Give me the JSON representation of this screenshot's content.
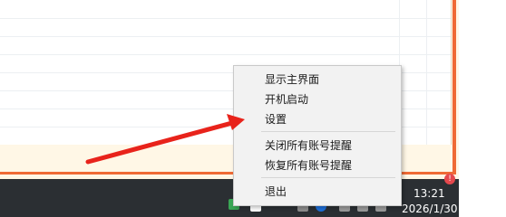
{
  "context_menu": {
    "items": [
      {
        "label": "显示主界面"
      },
      {
        "label": "开机启动"
      },
      {
        "label": "设置"
      },
      {
        "label": "关闭所有账号提醒"
      },
      {
        "label": "恢复所有账号提醒"
      },
      {
        "label": "退出"
      }
    ]
  },
  "clock": {
    "time": "13:21",
    "date": "2026/1/30"
  },
  "colors": {
    "arrow": "#e8231b",
    "frame": "#ef6a35",
    "taskbar": "#2b2f33"
  },
  "icons": {
    "notify": "notification-badge-icon",
    "tray": [
      "tray-app-icon",
      "tray-pinned-icon",
      "tray-network-icon",
      "tray-volume-icon"
    ]
  },
  "notify_badge": "!"
}
